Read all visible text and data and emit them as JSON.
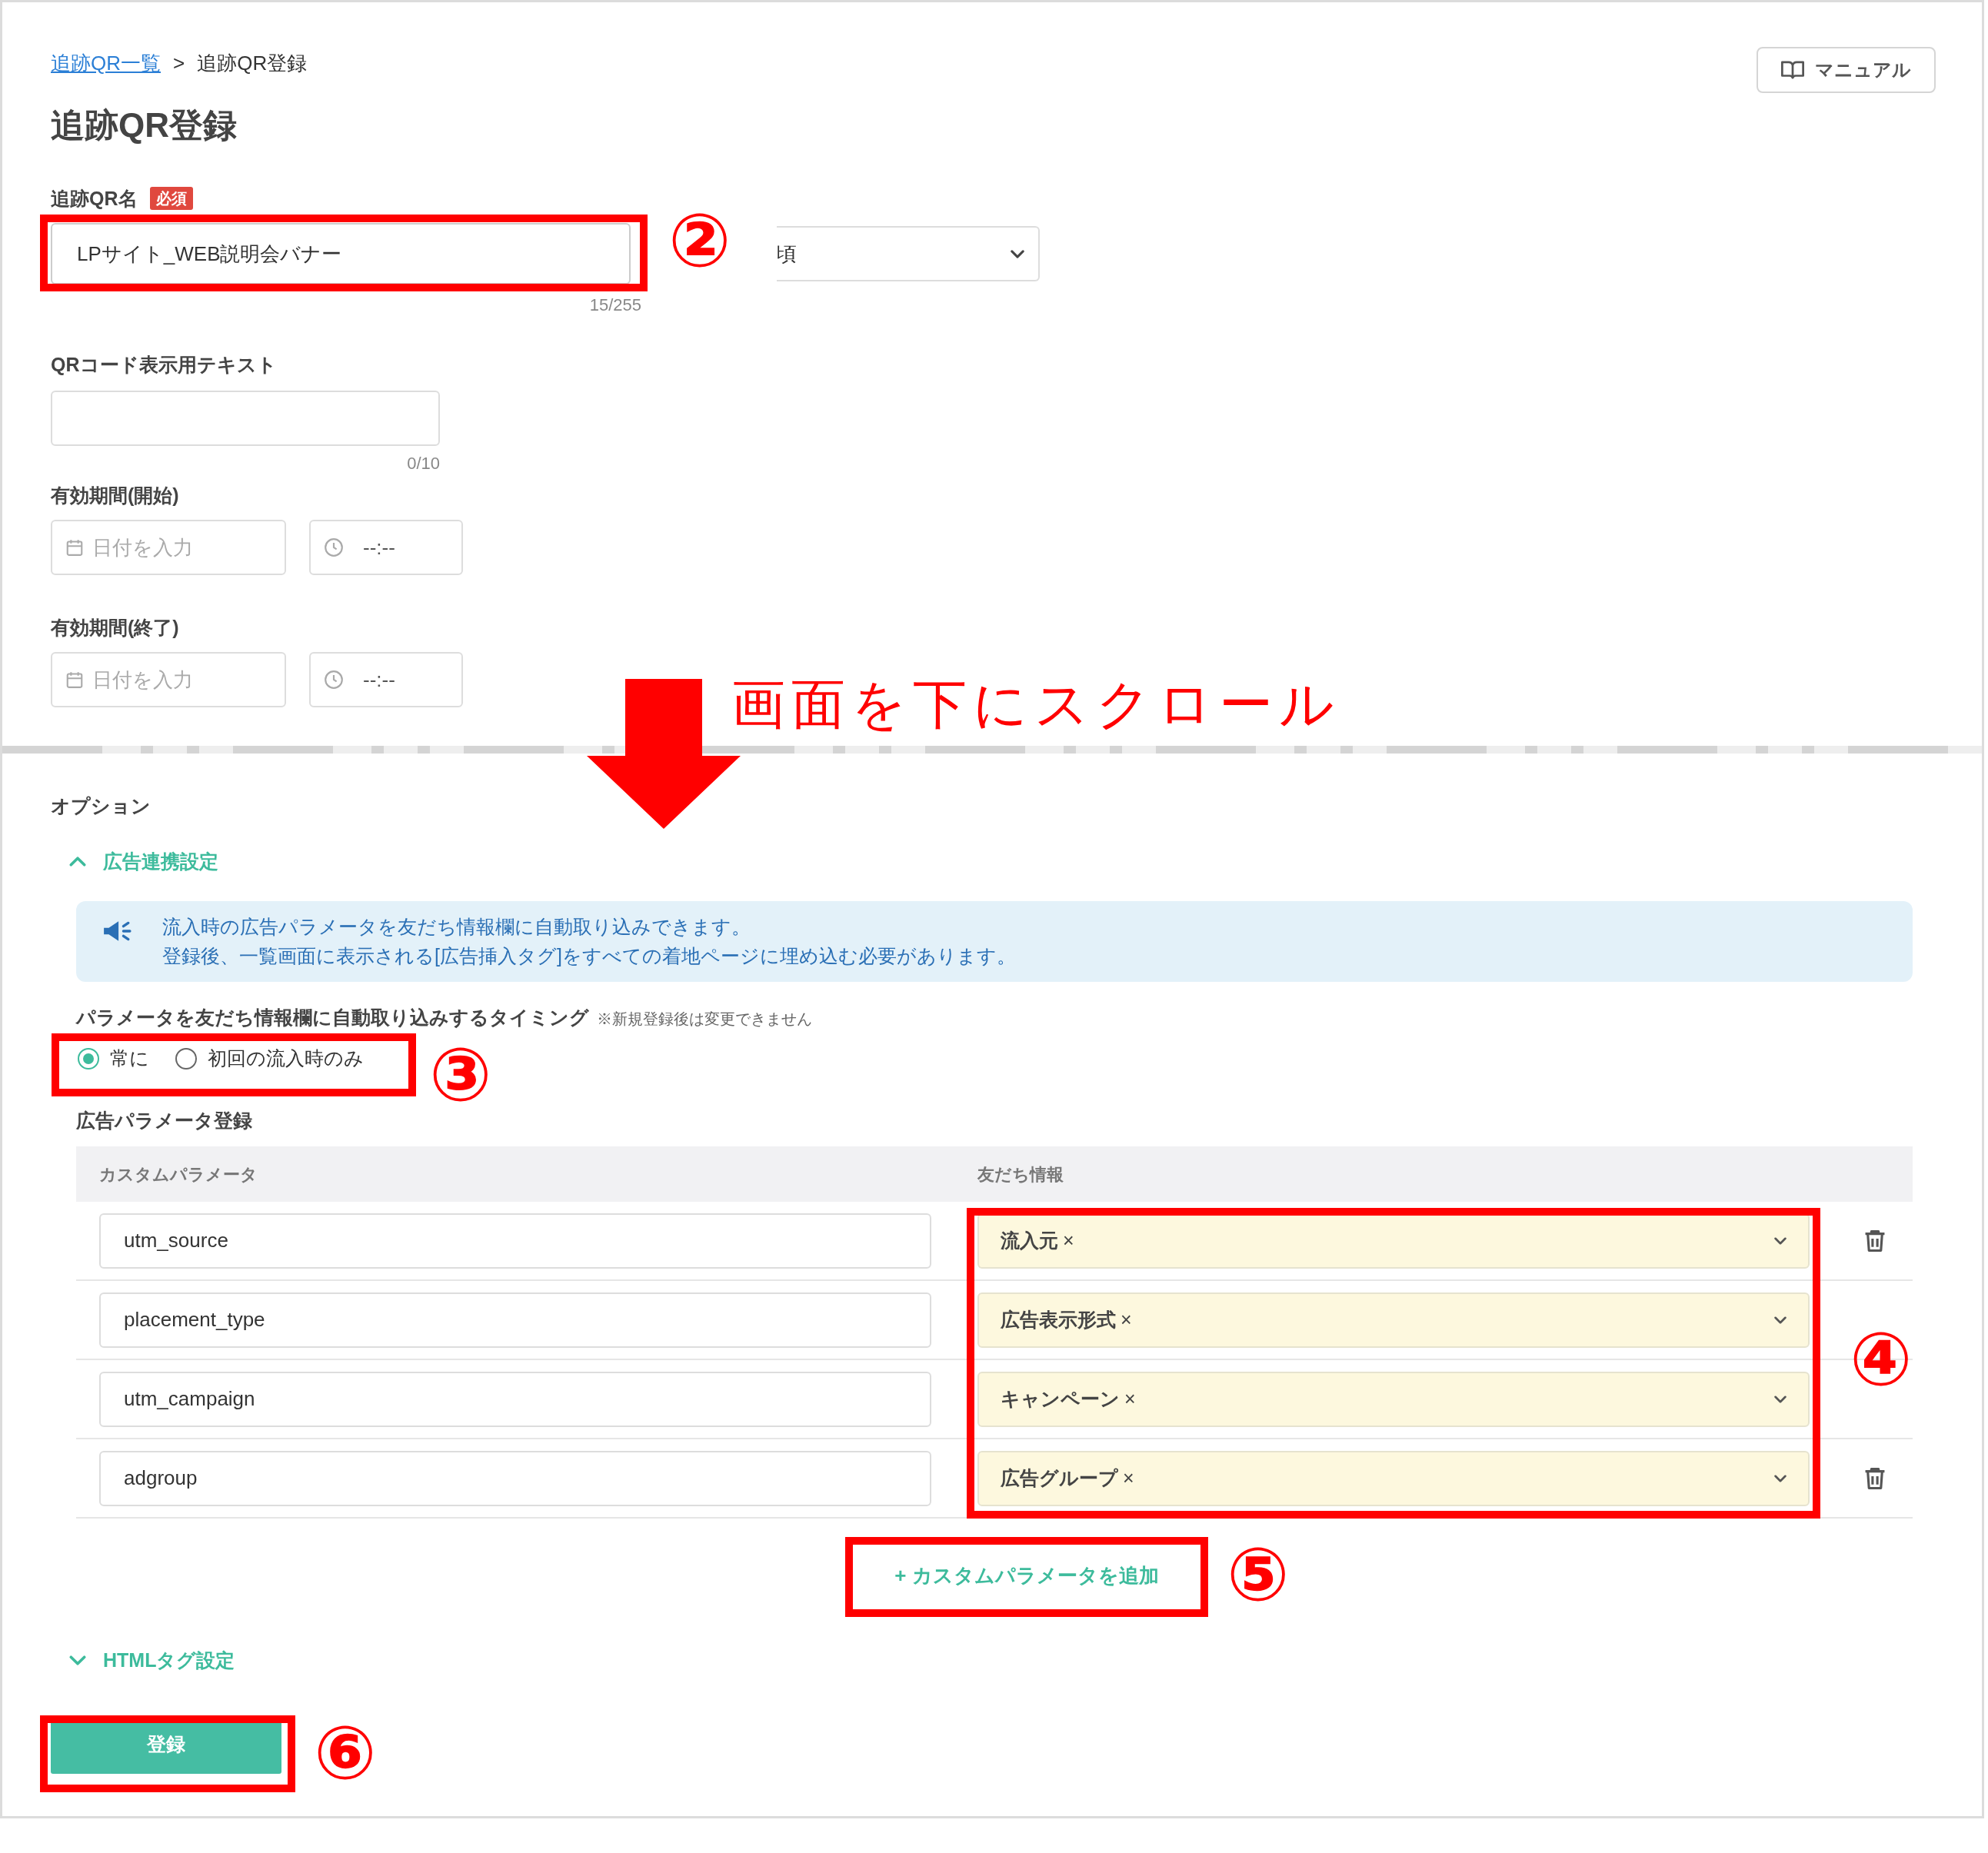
{
  "breadcrumb": [
    {
      "label": "追跡QR一覧",
      "link": true
    },
    {
      "label": ">",
      "link": false
    },
    {
      "label": "追跡QR登録",
      "link": false
    }
  ],
  "manual_button": "マニュアル",
  "title": "追跡QR登録",
  "name_field": {
    "label": "追跡QR名",
    "badge": "必須",
    "value": "LPサイト_WEB説明会バナー",
    "counter": "15/255"
  },
  "partial_select": {
    "value": "頃"
  },
  "display_text_field": {
    "label": "QRコード表示用テキスト",
    "counter": "0/10"
  },
  "periods": [
    {
      "label": "有効期間(開始)",
      "date_placeholder": "日付を入力",
      "time_placeholder": "--:--"
    },
    {
      "label": "有効期間(終了)",
      "date_placeholder": "日付を入力",
      "time_placeholder": "--:--"
    }
  ],
  "options": {
    "title": "オプション",
    "sections": [
      {
        "label": "広告連携設定",
        "expanded": true
      },
      {
        "label": "HTMLタグ設定",
        "expanded": false
      }
    ],
    "info": [
      "流入時の広告パラメータを友だち情報欄に自動取り込みできます。",
      "登録後、一覧画面に表示される[広告挿入タグ]をすべての着地ページに埋め込む必要があります。"
    ],
    "timing": {
      "label": "パラメータを友だち情報欄に自動取り込みするタイミング",
      "note": "※新規登録後は変更できません",
      "radios": [
        {
          "label": "常に",
          "selected": true
        },
        {
          "label": "初回の流入時のみ",
          "selected": false
        }
      ]
    },
    "params_title": "広告パラメータ登録",
    "table": {
      "columns": [
        "カスタムパラメータ",
        "友だち情報"
      ],
      "rows": [
        {
          "param": "utm_source",
          "friend_info": "流入元",
          "deletable": true
        },
        {
          "param": "placement_type",
          "friend_info": "広告表示形式",
          "deletable": false
        },
        {
          "param": "utm_campaign",
          "friend_info": "キャンペーン",
          "deletable": false
        },
        {
          "param": "adgroup",
          "friend_info": "広告グループ",
          "deletable": true
        }
      ]
    },
    "tag_remove": "×",
    "add_button": "+ カスタムパラメータを追加"
  },
  "submit_button": "登録",
  "annotations": {
    "scroll_note": "画面を下にスクロール",
    "steps": [
      "②",
      "③",
      "④",
      "⑤",
      "⑥"
    ]
  }
}
